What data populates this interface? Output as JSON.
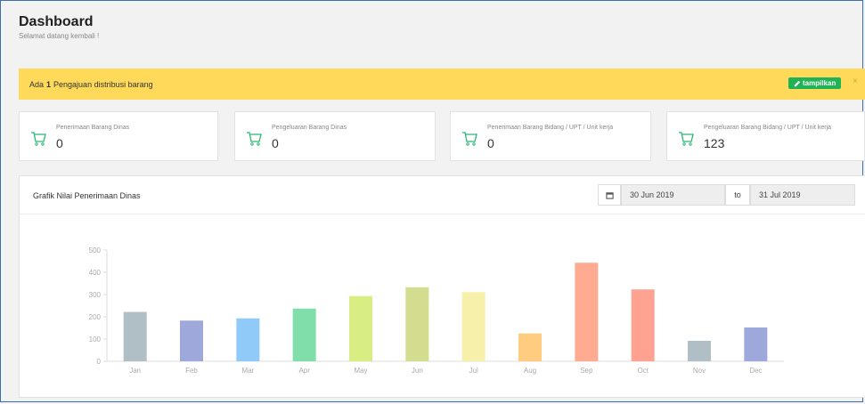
{
  "header": {
    "title": "Dashboard",
    "subtitle": "Selamat datang kembali !"
  },
  "alert": {
    "prefix": "Ada",
    "count": "1",
    "suffix": "Pengajuan distribusi barang",
    "button_label": "tampilkan",
    "close_label": "×",
    "color": "#ffd95a"
  },
  "stats": [
    {
      "label": "Penerimaan Barang Dinas",
      "value": "0",
      "icon": "cart-icon"
    },
    {
      "label": "Pengeluaran Barang Dinas",
      "value": "0",
      "icon": "cart-icon"
    },
    {
      "label": "Penerimaan Barang Bidang / UPT / Unit kerja",
      "value": "0",
      "icon": "cart-icon"
    },
    {
      "label": "Pengeluaran Barang Bidang / UPT / Unit kerja",
      "value": "123",
      "icon": "cart-icon"
    }
  ],
  "chart_section": {
    "title": "Grafik Nilai Penerimaan Dinas",
    "date_from": "30 Jun 2019",
    "to_label": "to",
    "date_to": "31 Jul 2019"
  },
  "chart_data": {
    "type": "bar",
    "categories": [
      "Jan",
      "Feb",
      "Mar",
      "Apr",
      "May",
      "Jun",
      "Jul",
      "Aug",
      "Sep",
      "Oct",
      "Nov",
      "Dec"
    ],
    "values": [
      222,
      183,
      193,
      237,
      293,
      333,
      311,
      125,
      443,
      323,
      92,
      152
    ],
    "colors": [
      "#b0bec5",
      "#9fa8da",
      "#90caf9",
      "#80deaa",
      "#d9ee82",
      "#d4dc8f",
      "#f7f0aa",
      "#ffcc80",
      "#ffab91",
      "#ffa291",
      "#b0bec5",
      "#9fa8da"
    ],
    "yticks": [
      0,
      100,
      200,
      300,
      400,
      500
    ],
    "ylim": [
      0,
      500
    ],
    "title": "",
    "xlabel": "",
    "ylabel": "",
    "grid": false
  }
}
